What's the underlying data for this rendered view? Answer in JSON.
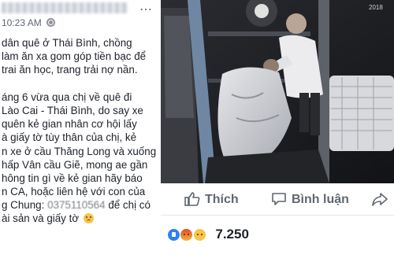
{
  "post": {
    "time": "10:23 AM",
    "text_lines": [
      "dân quê ở Thái Bình, chồng",
      "làm ăn xa gom góp tiền bạc để",
      "trai ăn học, trang trải nợ nần.",
      "",
      "áng 6 vừa qua chị về quê đi",
      "Lào Cai - Thái Bình, do say xe",
      "quên kẻ gian nhân cơ hội lấy",
      "à giấy tờ tùy thân của chị, kẻ",
      "n xe ở cầu Thăng Long và xuống",
      "hấp Vân cầu Giẽ, mong ae gần",
      "hông tin gì về kẻ gian hãy báo",
      "n CA, hoặc liên hệ với con của"
    ],
    "last_line_start": "g Chung:",
    "phone": "0375110564",
    "last_line_end": "để chị có",
    "final_line": "ài sản và giấy tờ"
  },
  "actions": {
    "like": "Thích",
    "comment": "Bình luận"
  },
  "reactions": {
    "count": "7.250",
    "types": [
      "like-icon",
      "angry-icon",
      "sad-icon"
    ]
  },
  "photo": {
    "timestamp": "2018"
  }
}
